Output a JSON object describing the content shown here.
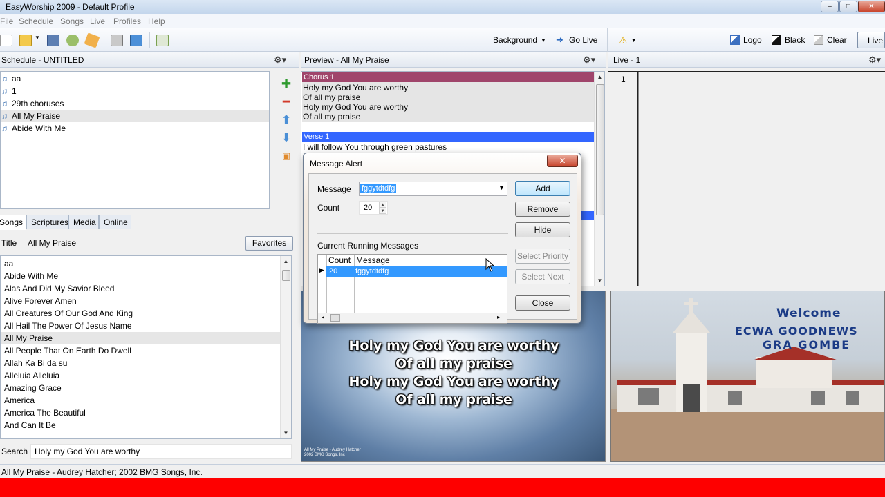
{
  "window": {
    "title": "EasyWorship 2009 - Default Profile"
  },
  "menu": [
    "File",
    "Schedule",
    "Songs",
    "Live",
    "Profiles",
    "Help"
  ],
  "toolbar": {
    "background_label": "Background",
    "go_live_label": "Go Live",
    "logo_label": "Logo",
    "black_label": "Black",
    "clear_label": "Clear",
    "live_label": "Live"
  },
  "schedule": {
    "header": "Schedule - UNTITLED",
    "items": [
      "aa",
      "1",
      "29th choruses",
      "All My Praise",
      "Abide With Me"
    ],
    "selected": "All My Praise"
  },
  "tabs": [
    "Songs",
    "Scriptures",
    "Media",
    "Online"
  ],
  "songs": {
    "title_label": "Title",
    "title_value": "All My Praise",
    "favorites_label": "Favorites",
    "items": [
      "aa",
      "Abide With Me",
      "Alas And Did My Savior Bleed",
      "Alive Forever Amen",
      "All Creatures Of Our God And King",
      "All Hail The Power Of Jesus Name",
      "All My Praise",
      "All People That On Earth Do Dwell",
      "Allah Ka Bi da su",
      "Alleluia Alleluia",
      "Amazing Grace",
      "America",
      "America The Beautiful",
      "And Can It Be"
    ],
    "selected": "All My Praise",
    "search_label": "Search",
    "search_value": "Holy my God You are worthy"
  },
  "preview": {
    "header": "Preview - All My Praise",
    "chorus_label": "Chorus 1",
    "chorus_lines": [
      "Holy my God You are worthy",
      "Of all my praise",
      "Holy my God You are worthy",
      "Of all my praise"
    ],
    "verse_label": "Verse 1",
    "verse_lines": [
      "I will follow You through green pastures"
    ],
    "projected_lines": [
      "Holy my God You are worthy",
      "Of all my praise",
      "Holy my God You are worthy",
      "Of all my praise"
    ],
    "credits": [
      "All My Praise - Audrey Hatcher",
      "2002 BMG Songs, Inc"
    ]
  },
  "live": {
    "header": "Live - 1",
    "slide_number": "1",
    "banner_welcome": "Welcome",
    "banner_name": "ECWA GOODNEWS",
    "banner_location": "GRA GOMBE"
  },
  "dialog": {
    "title": "Message Alert",
    "message_label": "Message",
    "message_value": "fggytdtdfg",
    "count_label": "Count",
    "count_value": "20",
    "running_label": "Current Running Messages",
    "grid_headers": [
      "Count",
      "Message"
    ],
    "grid_rows": [
      {
        "count": "20",
        "message": "fggytdtdfg"
      }
    ],
    "buttons": {
      "add": "Add",
      "remove": "Remove",
      "hide": "Hide",
      "select_priority": "Select Priority",
      "select_next": "Select Next",
      "close": "Close"
    }
  },
  "status": {
    "text": "All My Praise - Audrey Hatcher; 2002 BMG Songs, Inc."
  }
}
